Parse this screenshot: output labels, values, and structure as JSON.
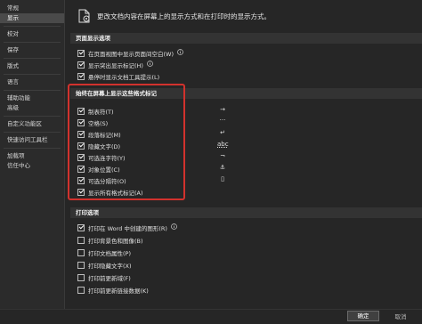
{
  "sidebar": {
    "items": [
      "常规",
      "显示",
      "校对",
      "保存",
      "版式",
      "语言",
      "辅助功能",
      "高级",
      "自定义功能区",
      "快速访问工具栏",
      "加载项",
      "信任中心"
    ],
    "active_index": 1
  },
  "header": {
    "text": "更改文档内容在屏幕上的显示方式和在打印时的显示方式。",
    "icon": "document-display-icon"
  },
  "page_display": {
    "title": "页面显示选项",
    "options": [
      {
        "label": "在页面视图中显示页面间空白(W)",
        "checked": true,
        "info": true
      },
      {
        "label": "显示突出显示标记(H)",
        "checked": true,
        "info": true
      },
      {
        "label": "悬停时显示文档工具提示(L)",
        "checked": true,
        "info": false
      }
    ]
  },
  "formatting_marks": {
    "title": "始终在屏幕上显示这些格式标记",
    "options": [
      {
        "label": "制表符(T)",
        "checked": true,
        "mark": "→"
      },
      {
        "label": "空格(S)",
        "checked": true,
        "mark": "···"
      },
      {
        "label": "段落标记(M)",
        "checked": true,
        "mark": "↵"
      },
      {
        "label": "隐藏文字(D)",
        "checked": true,
        "mark": "abc"
      },
      {
        "label": "可选连字符(Y)",
        "checked": true,
        "mark": "¬"
      },
      {
        "label": "对象位置(C)",
        "checked": true,
        "mark": "⚓"
      },
      {
        "label": "可选分隔符(O)",
        "checked": true,
        "mark": "▯"
      },
      {
        "label": "显示所有格式标记(A)",
        "checked": true,
        "mark": ""
      }
    ]
  },
  "print": {
    "title": "打印选项",
    "options": [
      {
        "label": "打印在 Word 中创建的图形(R)",
        "checked": true,
        "info": true
      },
      {
        "label": "打印背景色和图像(B)",
        "checked": false,
        "info": false
      },
      {
        "label": "打印文档属性(P)",
        "checked": false,
        "info": false
      },
      {
        "label": "打印隐藏文字(X)",
        "checked": false,
        "info": false
      },
      {
        "label": "打印前更新域(F)",
        "checked": false,
        "info": false
      },
      {
        "label": "打印前更新链接数据(K)",
        "checked": false,
        "info": false
      }
    ]
  },
  "footer": {
    "ok_label": "确定",
    "cancel_label": "取消"
  },
  "colors": {
    "highlight_box": "#d2322d",
    "sidebar_active": "#4a4a4a"
  }
}
